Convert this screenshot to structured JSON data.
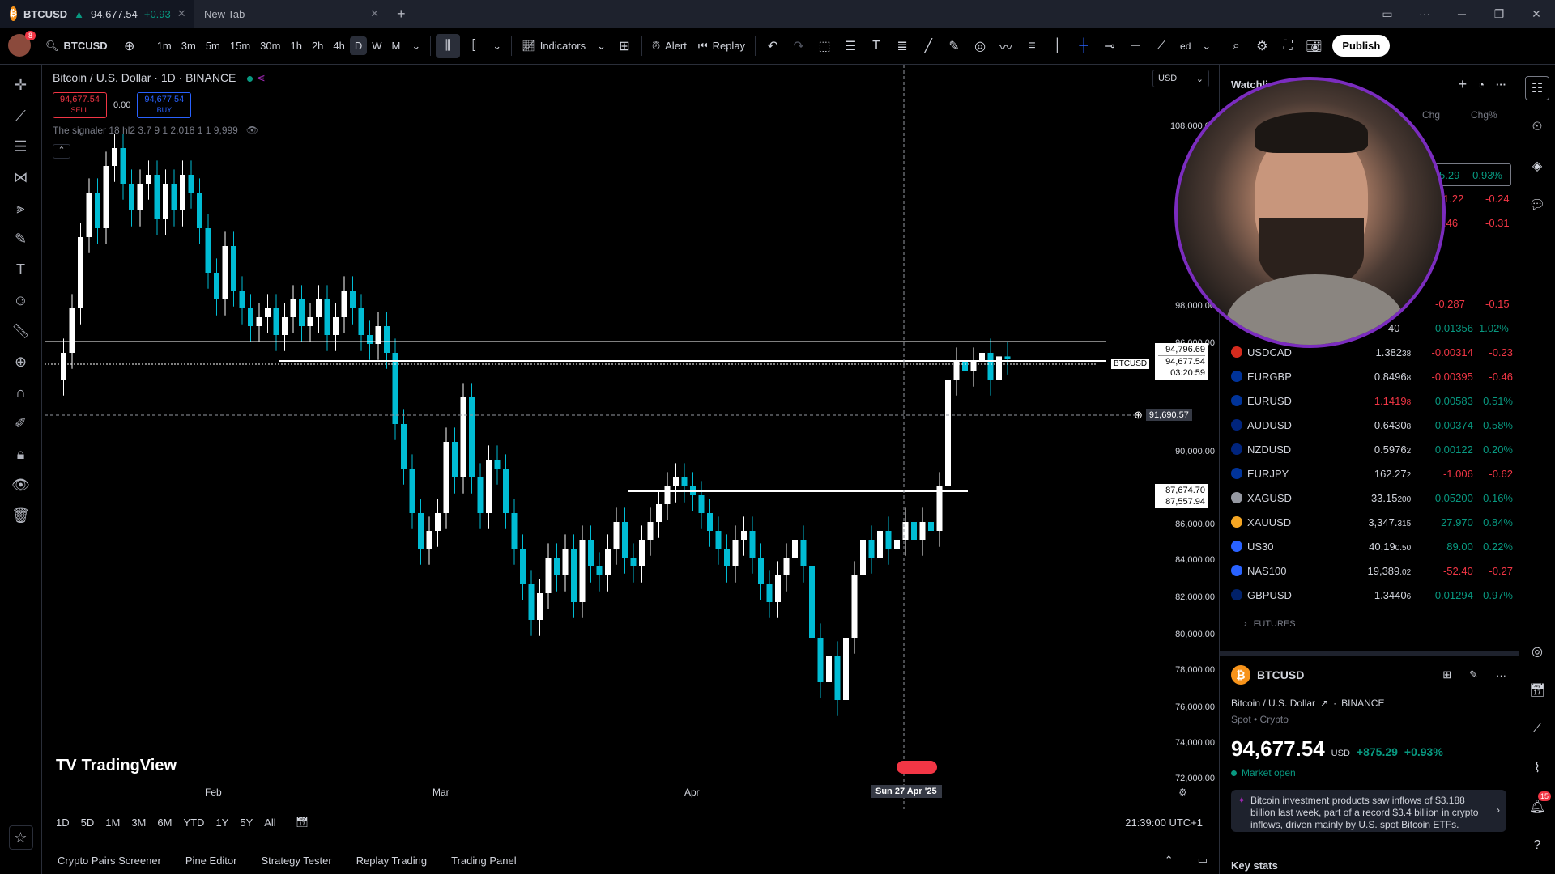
{
  "titlebar": {
    "tab1": "BTCUSD",
    "tab1_price": "94,677.54",
    "tab1_change": "+0.93",
    "tab2": "New Tab"
  },
  "toolbar": {
    "symbol": "BTCUSD",
    "intervals": [
      "1m",
      "3m",
      "5m",
      "15m",
      "30m",
      "1h",
      "2h",
      "4h",
      "D",
      "W",
      "M"
    ],
    "selected_interval": "D",
    "indicators": "Indicators",
    "alert": "Alert",
    "replay": "Replay",
    "publish": "Publish",
    "partial": "ed",
    "badge": "8"
  },
  "chart": {
    "title": "Bitcoin / U.S. Dollar · 1D · BINANCE",
    "sell_price": "94,677.54",
    "sell_label": "SELL",
    "spread": "0.00",
    "buy_price": "94,677.54",
    "buy_label": "BUY",
    "indicator": "The signaler 18 hl2 3.7 9 1 2,018 1 1 9,999",
    "currency": "USD",
    "watermark": "TradingView",
    "crosshair_date": "Sun 27 Apr '25",
    "time": "21:39:00 UTC+1",
    "btc_tag": "BTCUSD",
    "last_price": "94,677.54",
    "high_price": "94,796.69",
    "countdown": "03:20:59",
    "crosshair_price": "91,690.57",
    "level1": "87,674.70",
    "level2": "87,557.94"
  },
  "price_axis": [
    "108,000.00",
    "106,0",
    "104",
    "102",
    "100,0",
    "98,000.00",
    "96,000.00",
    "90,000.00",
    "86,000.00",
    "84,000.00",
    "82,000.00",
    "80,000.00",
    "78,000.00",
    "76,000.00",
    "74,000.00",
    "72,000.00"
  ],
  "time_axis": [
    "Feb",
    "Mar",
    "Apr"
  ],
  "ranges": [
    "1D",
    "5D",
    "1M",
    "3M",
    "6M",
    "YTD",
    "1Y",
    "5Y",
    "All"
  ],
  "bottom_tabs": [
    "Crypto Pairs Screener",
    "Pine Editor",
    "Strategy Tester",
    "Replay Trading",
    "Trading Panel"
  ],
  "watchlist": {
    "title": "Watchli",
    "col_chg": "Chg",
    "col_chgp": "Chg%",
    "partial_rows": [
      {
        "chg": "5.29",
        "chgp": "0.93%"
      },
      {
        "chg": "1.22",
        "chgp": "-0.24"
      },
      {
        "chg": ".46",
        "chgp": "-0.31"
      },
      {
        "chg": "-0.287",
        "chgp": "-0.15"
      },
      {
        "chg": "0.01356",
        "chgp": "1.02%",
        "last": "40"
      }
    ],
    "rows": [
      {
        "sym": "USDCAD",
        "last": "1.382",
        "last_small": "38",
        "chg": "-0.00314",
        "chgp": "-0.23",
        "flag": "#d52b1e",
        "neg": true
      },
      {
        "sym": "EURGBP",
        "last": "0.8496",
        "last_small": "8",
        "chg": "-0.00395",
        "chgp": "-0.46",
        "flag": "#003399",
        "neg": true
      },
      {
        "sym": "EURUSD",
        "last": "1.1419",
        "last_small": "8",
        "chg": "0.00583",
        "chgp": "0.51%",
        "flag": "#003399",
        "neg": false,
        "lastneg": true
      },
      {
        "sym": "AUDUSD",
        "last": "0.6430",
        "last_small": "8",
        "chg": "0.00374",
        "chgp": "0.58%",
        "flag": "#00247d",
        "neg": false
      },
      {
        "sym": "NZDUSD",
        "last": "0.5976",
        "last_small": "2",
        "chg": "0.00122",
        "chgp": "0.20%",
        "flag": "#00247d",
        "neg": false
      },
      {
        "sym": "EURJPY",
        "last": "162.27",
        "last_small": "2",
        "chg": "-1.006",
        "chgp": "-0.62",
        "flag": "#003399",
        "neg": true
      },
      {
        "sym": "XAGUSD",
        "last": "33.15",
        "last_small": "200",
        "chg": "0.05200",
        "chgp": "0.16%",
        "flag": "#9598a1",
        "neg": false
      },
      {
        "sym": "XAUUSD",
        "last": "3,347.",
        "last_small": "315",
        "chg": "27.970",
        "chgp": "0.84%",
        "flag": "#f5a623",
        "neg": false
      },
      {
        "sym": "US30",
        "last": "40,19",
        "last_small": "0.50",
        "chg": "89.00",
        "chgp": "0.22%",
        "flag": "#2962ff",
        "neg": false
      },
      {
        "sym": "NAS100",
        "last": "19,389",
        "last_small": ".02",
        "chg": "-52.40",
        "chgp": "-0.27",
        "flag": "#2962ff",
        "neg": true
      },
      {
        "sym": "GBPUSD",
        "last": "1.3440",
        "last_small": "6",
        "chg": "0.01294",
        "chgp": "0.97%",
        "flag": "#012169",
        "neg": false
      }
    ],
    "futures": "FUTURES"
  },
  "details": {
    "symbol": "BTCUSD",
    "name": "Bitcoin / U.S. Dollar",
    "exchange": "BINANCE",
    "type": "Spot • Crypto",
    "price": "94,677.54",
    "currency": "USD",
    "change": "+875.29",
    "change_pct": "+0.93%",
    "status": "Market open",
    "news": "Bitcoin investment products saw inflows of $3.188 billion last week, part of a record $3.4 billion in crypto inflows, driven mainly by U.S. spot Bitcoin ETFs.",
    "keystats": "Key stats",
    "notif": "15"
  }
}
